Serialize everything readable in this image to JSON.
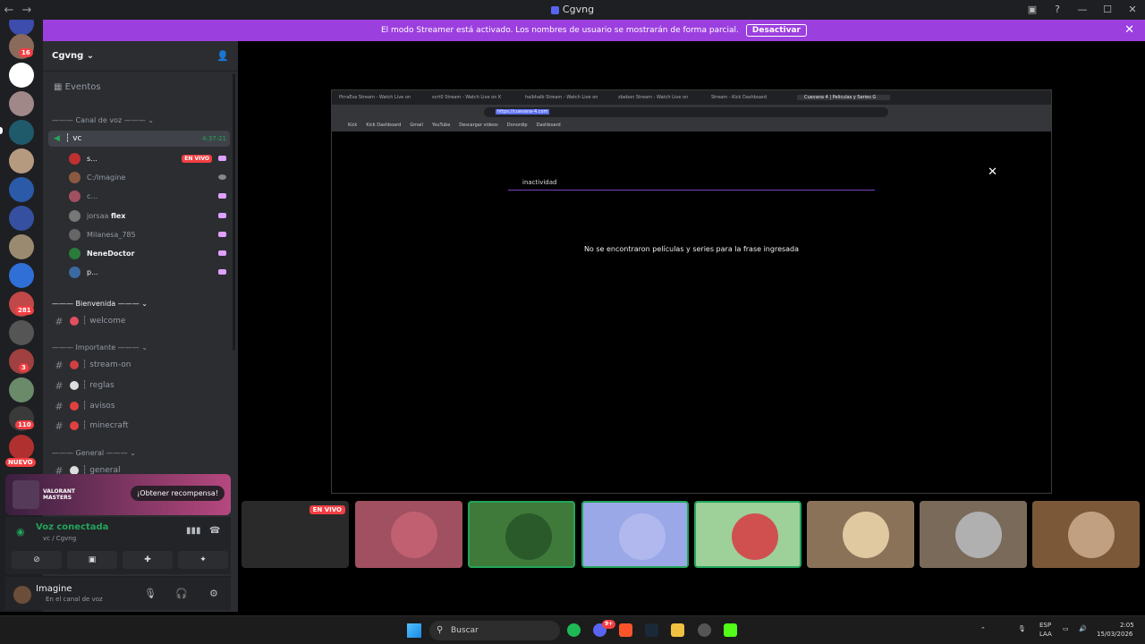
{
  "window": {
    "title": "Cgvng",
    "back": "←",
    "forward": "→",
    "controls": [
      "▣",
      "?",
      "—",
      "☐",
      "✕"
    ]
  },
  "banner": {
    "text": "El modo Streamer está activado. Los nombres de usuario se mostrarán de forma parcial.",
    "button": "Desactivar",
    "close": "✕"
  },
  "guild_badges": [
    "16",
    "281",
    "3",
    "110",
    "NUEVO"
  ],
  "server": {
    "name": "Cgvng",
    "chevron": "⌄",
    "add_user_icon": "👤"
  },
  "events_label": "Eventos",
  "voice_category": "Canal de voz",
  "voice_channel": {
    "name": "┆ vc",
    "timer": "4:37:21"
  },
  "voice_users": [
    {
      "name": "s...",
      "live": "EN VIVO"
    },
    {
      "name": "C:/Imagine"
    },
    {
      "name": "c..."
    },
    {
      "name": "jorsaa",
      "tag": "flex"
    },
    {
      "name": "Milanesa_785"
    },
    {
      "name": "NeneDoctor"
    },
    {
      "name": "p..."
    }
  ],
  "categories": {
    "bienvenida": "Bienvenida",
    "importante": "Importante",
    "general": "General"
  },
  "channels": {
    "welcome": "┆ welcome",
    "stream_on": "┆ stream-on",
    "reglas": "┆ reglas",
    "avisos": "┆ avisos",
    "minecraft": "┆ minecraft",
    "general": "┆ general"
  },
  "promo": {
    "logo_line1": "VALORANT",
    "logo_line2": "MASTERS",
    "button": "¡Obtener recompensa!"
  },
  "voice_panel": {
    "status": "Voz conectada",
    "sub": "vc / Cgvng"
  },
  "user_panel": {
    "name": "Imagine",
    "status": "En el canal de voz"
  },
  "stream": {
    "tabs": [
      "PirraEsa Stream - Watch Live on",
      "scrt0 Stream - Watch Live on K",
      "halbhalb Stream - Watch Live on",
      "zbebon Stream - Watch Live on",
      "Stream - Kick Dashboard",
      "Cuevana 4 | Películas y Series G"
    ],
    "url": "https://cuevana-4.com",
    "bookmarks": [
      "Kick",
      "Kick Dashboard",
      "Gmail",
      "YouTube",
      "Descargar videos",
      "Donordip",
      "Dashboard"
    ],
    "search_value": "inactividad",
    "empty_message": "No se encontraron películas y series para la frase ingresada"
  },
  "tiles": {
    "live": "EN VIVO"
  },
  "taskbar": {
    "search": "Buscar",
    "lang1": "ESP",
    "lang2": "LAA",
    "time": "2:05",
    "date": "15/03/2026",
    "discord_badge": "9+"
  }
}
